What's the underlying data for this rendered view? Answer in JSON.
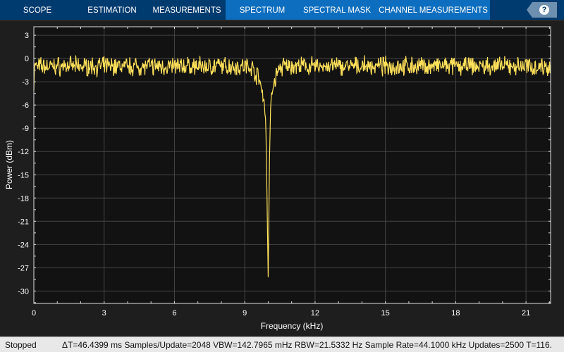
{
  "tabs": [
    {
      "label": "SCOPE"
    },
    {
      "label": "ESTIMATION"
    },
    {
      "label": "MEASUREMENTS"
    },
    {
      "label": "SPECTRUM"
    },
    {
      "label": "SPECTRAL MASK"
    },
    {
      "label": "CHANNEL MEASUREMENTS"
    }
  ],
  "help": {
    "label": "?",
    "icon": "help-icon"
  },
  "status": {
    "state": "Stopped",
    "info": "ΔT=46.4399 ms  Samples/Update=2048  VBW=142.7965 mHz  RBW=21.5332 Hz  Sample Rate=44.1000 kHz  Updates=2500  T=116."
  },
  "colors": {
    "trace": "#ffe15a",
    "plot_bg": "#121212",
    "tab_bar": "#003b6f",
    "tab_active": "#0d6ebf"
  },
  "chart_data": {
    "type": "line",
    "xlabel": "Frequency (kHz)",
    "ylabel": "Power (dBm)",
    "xlim": [
      0,
      22.05
    ],
    "ylim": [
      -31.6,
      4.1
    ],
    "xticks": [
      0,
      3,
      6,
      9,
      12,
      15,
      18,
      21
    ],
    "yticks": [
      3,
      0,
      -3,
      -6,
      -9,
      -12,
      -15,
      -18,
      -21,
      -24,
      -27,
      -30
    ],
    "grid": true,
    "series": [
      {
        "noise_floor_dBm": -1.0,
        "noise_ripple_dB": 1.1,
        "notch": {
          "x": [
            9.3,
            9.6,
            9.8,
            9.9,
            9.95,
            10.0,
            10.05,
            10.1,
            10.2,
            10.4,
            10.6
          ],
          "y": [
            -1.2,
            -2.5,
            -4.8,
            -8.5,
            -18,
            -28.2,
            -14,
            -6.5,
            -3.5,
            -1.6,
            -1.1
          ]
        }
      }
    ]
  }
}
